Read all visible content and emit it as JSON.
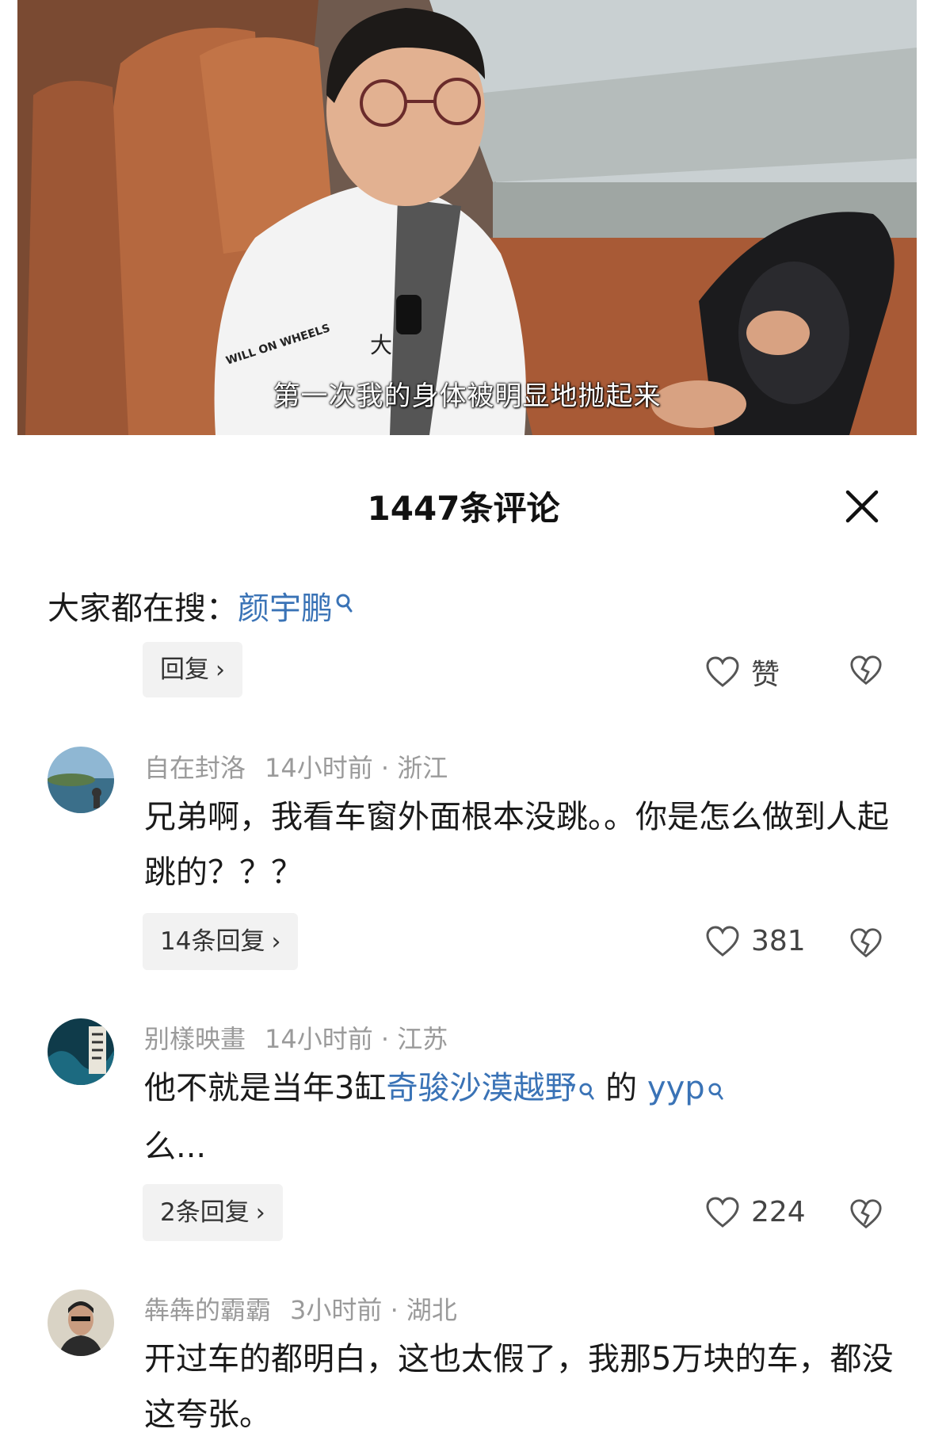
{
  "video": {
    "subtitle": "第一次我的身体被明显地抛起来",
    "shirt_text": "WILL ON WHEELS"
  },
  "sheet": {
    "title": "1447条评论",
    "close_icon": "close-icon"
  },
  "search": {
    "label": "大家都在搜：",
    "keyword": "颜宇鹏"
  },
  "prev_comment": {
    "reply_label": "回复",
    "like_label": "赞"
  },
  "comments": [
    {
      "username": "自在封洛",
      "time": "14小时前",
      "location": "浙江",
      "text": "兄弟啊，我看车窗外面根本没跳。。你是怎么做到人起跳的？？？",
      "replies": "14条回复",
      "likes": "381"
    },
    {
      "username": "别樣映畫",
      "time": "14小时前",
      "location": "江苏",
      "text_a": "他不就是当年3缸",
      "link_a": "奇骏沙漠越野",
      "text_b": "的",
      "link_b": "yyp",
      "text_c": "么...",
      "replies": "2条回复",
      "likes": "224"
    },
    {
      "username": "犇犇的霸霸",
      "time": "3小时前",
      "location": "湖北",
      "text": "开过车的都明白，这也太假了，我那5万块的车，都没这夸张。"
    }
  ],
  "colors": {
    "link": "#3a73b6",
    "meta": "#9a9a9a",
    "button_bg": "#f2f2f2"
  }
}
